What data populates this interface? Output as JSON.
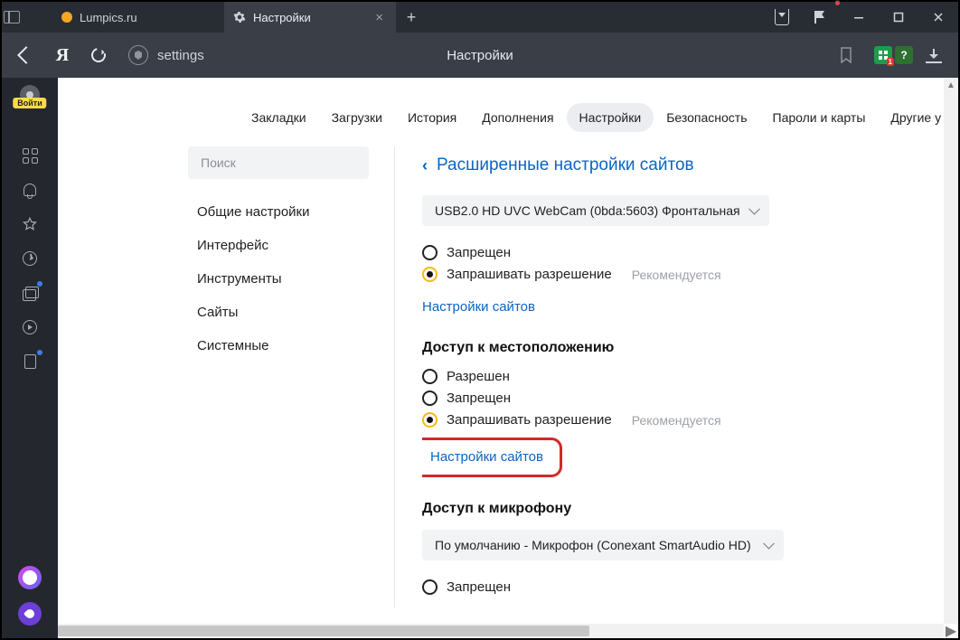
{
  "titlebar": {
    "tab_inactive": {
      "title": "Lumpics.ru"
    },
    "tab_active": {
      "title": "Настройки"
    }
  },
  "toolbar": {
    "omnibox_text": "settings",
    "page_title": "Настройки",
    "ext1_count": "1",
    "ext2_label": "?"
  },
  "sidebar": {
    "login_label": "Войти"
  },
  "topnav": {
    "items": [
      {
        "label": "Закладки"
      },
      {
        "label": "Загрузки"
      },
      {
        "label": "История"
      },
      {
        "label": "Дополнения"
      },
      {
        "label": "Настройки"
      },
      {
        "label": "Безопасность"
      },
      {
        "label": "Пароли и карты"
      },
      {
        "label": "Другие у"
      }
    ],
    "active_index": 4
  },
  "leftnav": {
    "search_placeholder": "Поиск",
    "items": [
      {
        "label": "Общие настройки"
      },
      {
        "label": "Интерфейс"
      },
      {
        "label": "Инструменты"
      },
      {
        "label": "Сайты"
      },
      {
        "label": "Системные"
      }
    ]
  },
  "main": {
    "breadcrumb": "Расширенные настройки сайтов",
    "camera_select": "USB2.0 HD UVC WebCam (0bda:5603) Фронтальная",
    "opt_denied": "Запрещен",
    "opt_ask": "Запрашивать разрешение",
    "recommended": "Рекомендуется",
    "site_settings_link": "Настройки сайтов",
    "location_title": "Доступ к местоположению",
    "opt_allowed": "Разрешен",
    "mic_title": "Доступ к микрофону",
    "mic_select": "По умолчанию - Микрофон (Conexant SmartAudio HD)"
  }
}
